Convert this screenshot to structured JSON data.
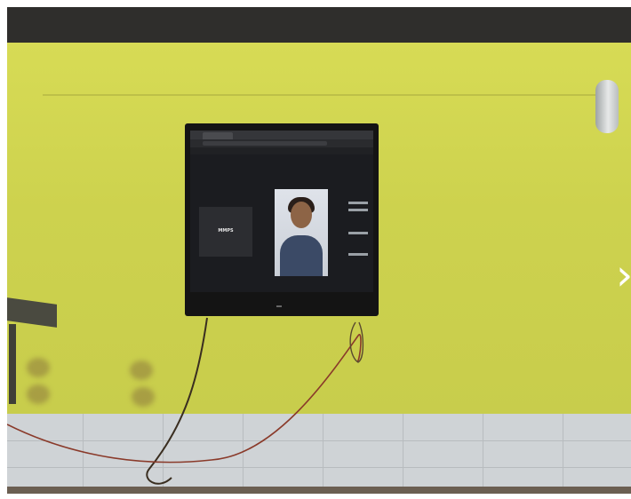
{
  "scene": {
    "description_tags": [
      "wall-mounted-tv",
      "video-call",
      "classroom-wall"
    ],
    "colors": {
      "wall": "#cfd552",
      "top_band": "#2f2e2c",
      "tiles": "#cfd3d6",
      "tv_frame": "#141414"
    }
  },
  "tv_screen": {
    "participant_tile_name": "MMPS",
    "navigation": {
      "next_arrow_glyph": "›"
    }
  }
}
